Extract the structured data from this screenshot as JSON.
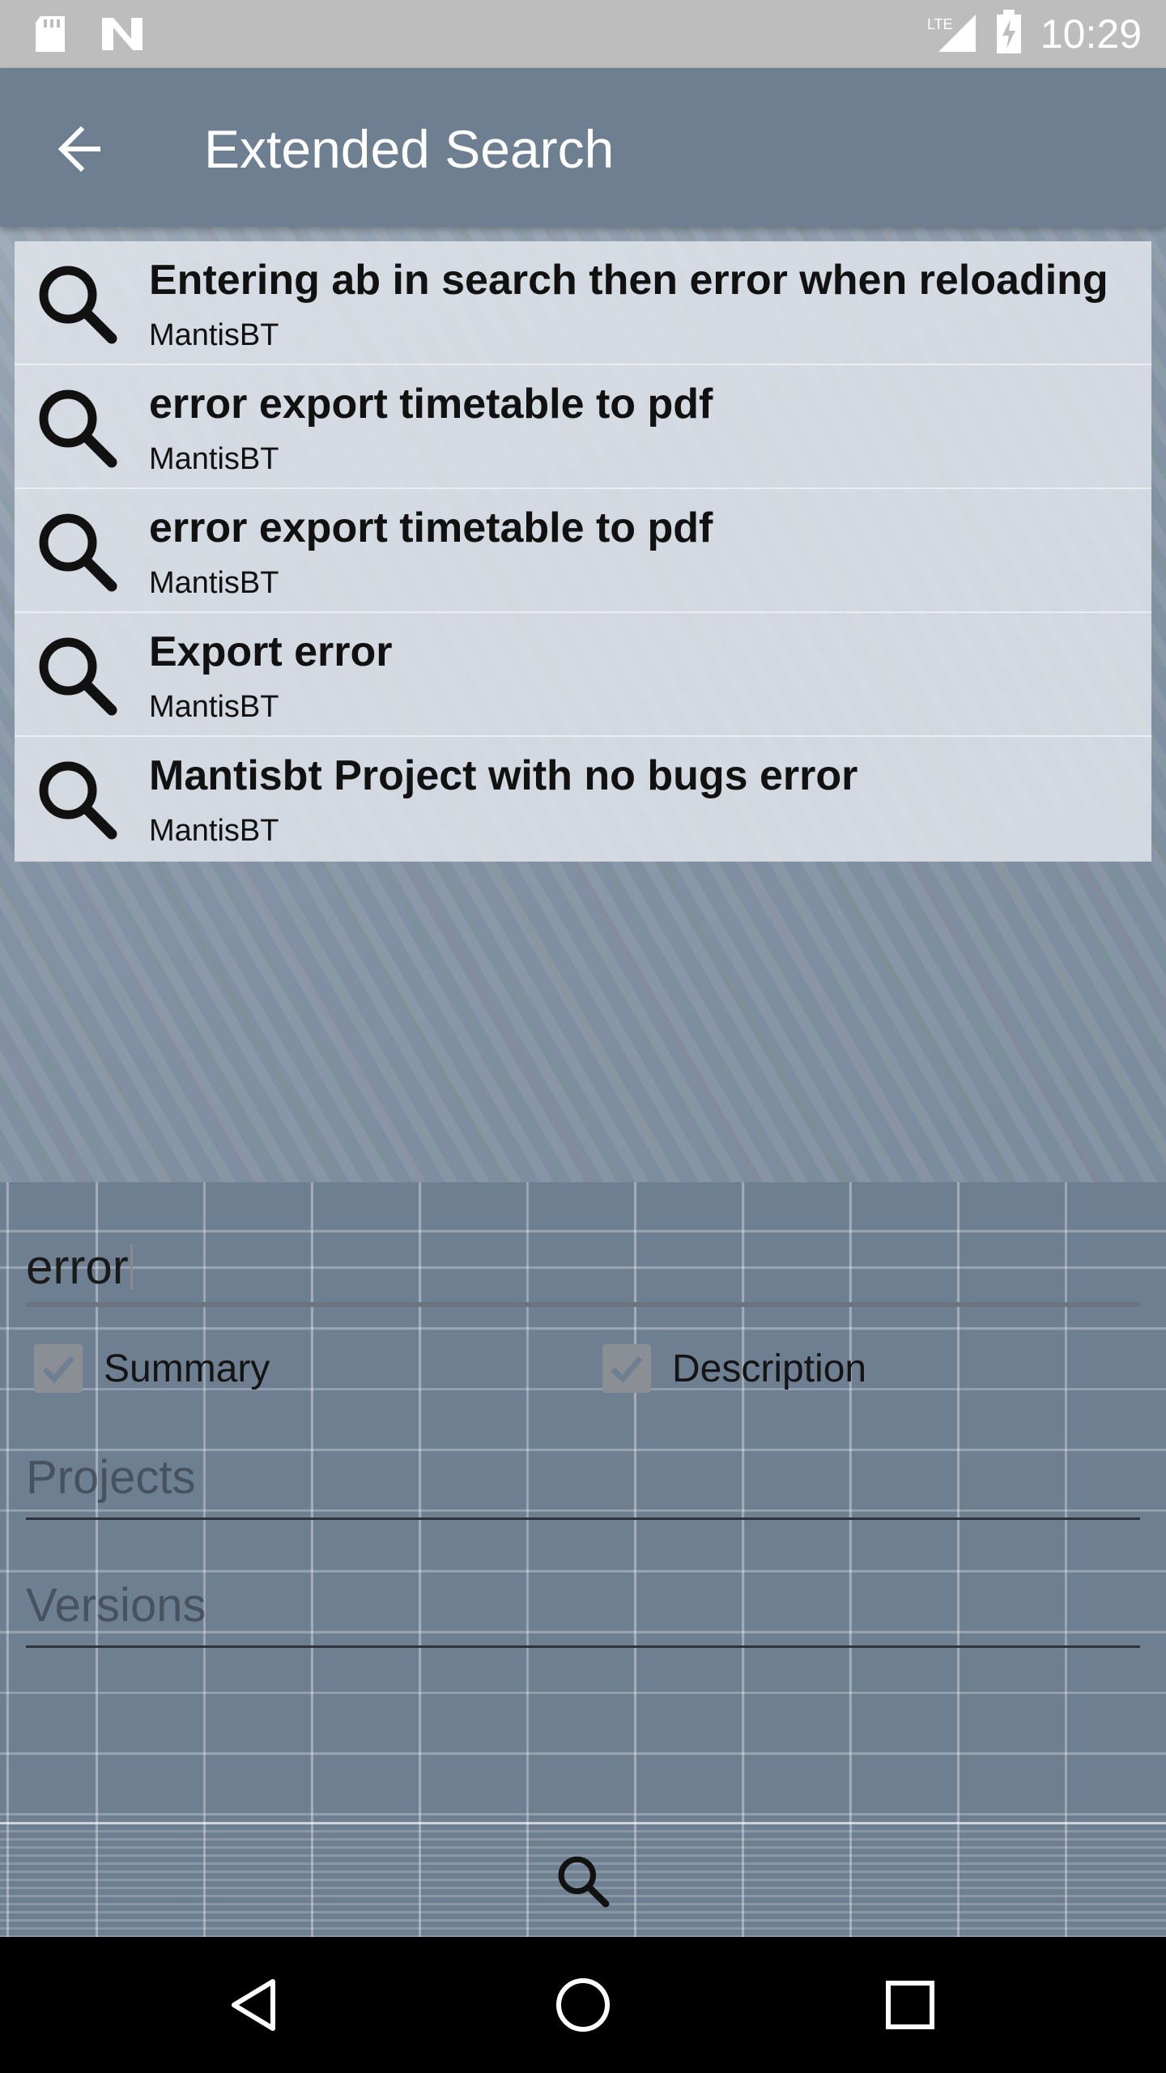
{
  "status_bar": {
    "time": "10:29",
    "network": "LTE",
    "icons": [
      "sd-card-icon",
      "n-logo-icon",
      "lte-signal-icon",
      "battery-charging-icon"
    ]
  },
  "app_bar": {
    "title": "Extended Search",
    "back_icon": "arrow-back-icon"
  },
  "suggestions": [
    {
      "title": "Entering ab in search then error when reloading",
      "subtitle": "MantisBT"
    },
    {
      "title": "error export timetable to pdf",
      "subtitle": "MantisBT"
    },
    {
      "title": "error export timetable to pdf",
      "subtitle": "MantisBT"
    },
    {
      "title": "Export error",
      "subtitle": "MantisBT"
    },
    {
      "title": "Mantisbt Project with no bugs error",
      "subtitle": "MantisBT"
    }
  ],
  "form": {
    "query_value": "error",
    "summary_label": "Summary",
    "summary_checked": true,
    "description_label": "Description",
    "description_checked": true,
    "projects_placeholder": "Projects",
    "versions_placeholder": "Versions",
    "search_icon": "search-icon"
  },
  "nav_bar": {
    "icons": [
      "back-triangle-icon",
      "home-circle-icon",
      "recents-square-icon"
    ]
  },
  "colors": {
    "app_bar": "#6e7f92",
    "status_bar": "#bdbdbd",
    "nav_bar": "#000000"
  }
}
